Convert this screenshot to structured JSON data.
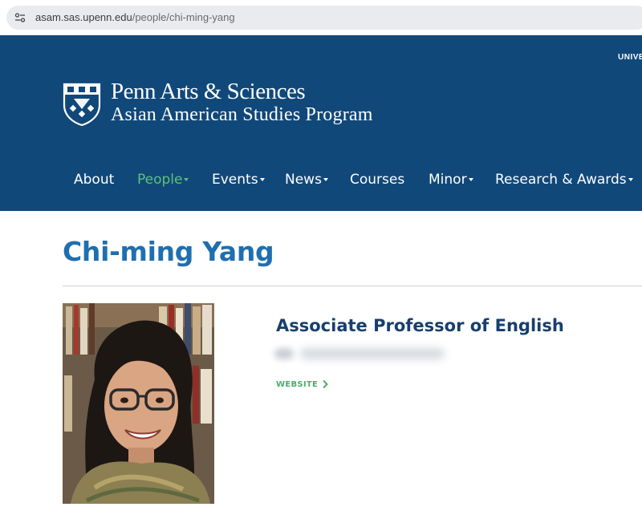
{
  "browser": {
    "url_host": "asam.sas.upenn.edu",
    "url_path": "/people/chi-ming-yang"
  },
  "header": {
    "univ_link": "UNIVE",
    "brand_line1": "Penn Arts & Sciences",
    "brand_line2": "Asian American Studies Program",
    "background_color": "#11487a"
  },
  "nav": {
    "items": [
      {
        "label": "About",
        "dropdown": false,
        "active": false
      },
      {
        "label": "People",
        "dropdown": true,
        "active": true
      },
      {
        "label": "Events",
        "dropdown": true,
        "active": false
      },
      {
        "label": "News",
        "dropdown": true,
        "active": false
      },
      {
        "label": "Courses",
        "dropdown": false,
        "active": false
      },
      {
        "label": "Minor",
        "dropdown": true,
        "active": false
      },
      {
        "label": "Research & Awards",
        "dropdown": true,
        "active": false
      }
    ],
    "active_color": "#5ec07a"
  },
  "profile": {
    "name": "Chi-ming Yang",
    "title": "Associate Professor of English",
    "website_label": "WEBSITE",
    "title_color": "#1f6fb0",
    "link_color": "#4cad68"
  }
}
